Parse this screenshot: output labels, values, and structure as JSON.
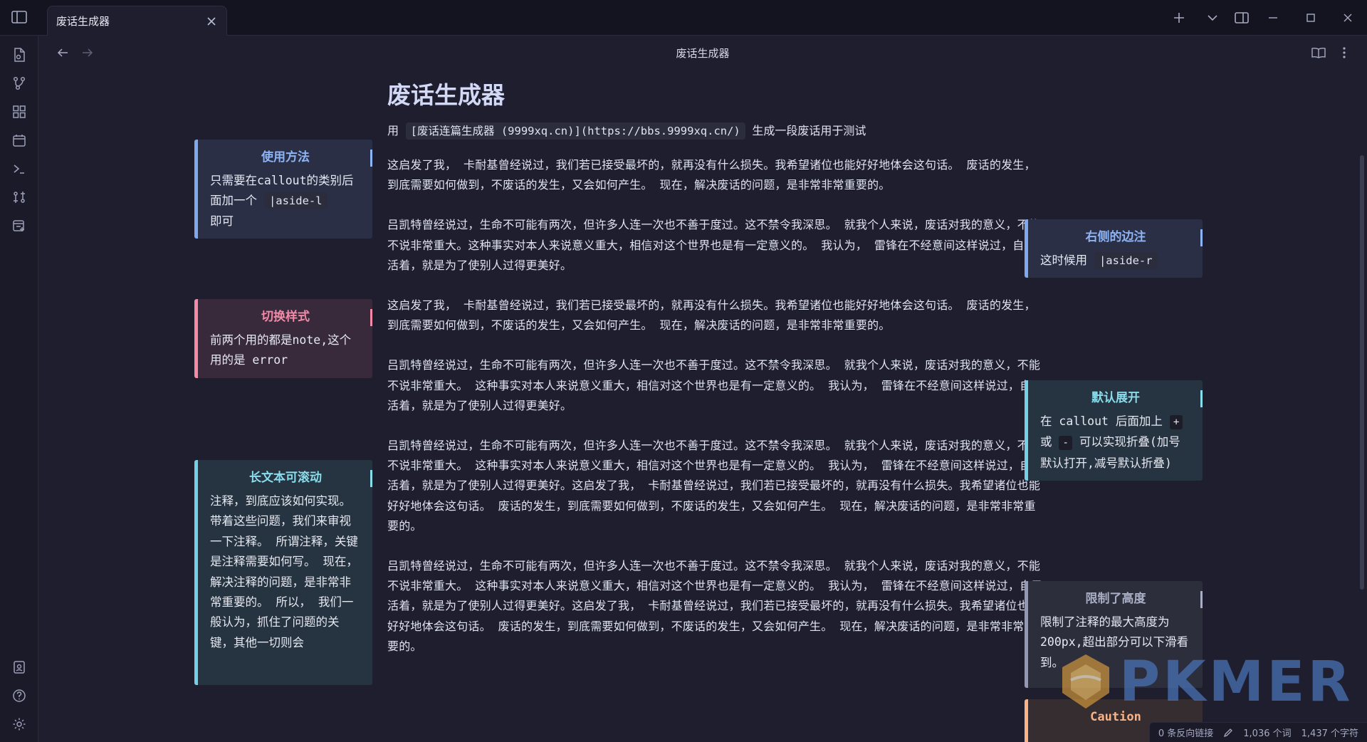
{
  "window": {
    "tab_title": "废话生成器",
    "view_title": "废话生成器"
  },
  "icons": {
    "titlebar": [
      "sidebar-toggle-icon",
      "close-icon",
      "plus-icon",
      "chevron-down-icon",
      "split-layout-icon",
      "minimize-icon",
      "maximize-icon",
      "close-window-icon"
    ],
    "ribbon": [
      "files-icon",
      "graph-icon",
      "blocks-icon",
      "calendar-icon",
      "terminal-icon",
      "diff-icon",
      "new-tab-icon",
      "vault-icon",
      "help-icon",
      "settings-icon"
    ],
    "view": [
      "arrow-left-icon",
      "arrow-right-icon",
      "book-open-icon",
      "more-vertical-icon"
    ]
  },
  "colors": {
    "background": "#1e1e2e",
    "note": "#7fa9ee",
    "error": "#f38ba8",
    "cyan": "#89dceb",
    "gray": "#9399b2",
    "orange": "#fab387"
  },
  "doc": {
    "title": "废话生成器",
    "intro_prefix": "用",
    "intro_code": "[废话连篇生成器 (9999xq.cn)](https://bbs.9999xq.cn/)",
    "intro_suffix": "生成一段废话用于测试",
    "paragraphs": [
      "这启发了我， 卡耐基曾经说过，我们若已接受最坏的，就再没有什么损失。我希望诸位也能好好地体会这句话。 废话的发生，到底需要如何做到，不废话的发生，又会如何产生。 现在，解决废话的问题，是非常非常重要的。",
      "吕凯特曾经说过，生命不可能有两次，但许多人连一次也不善于度过。这不禁令我深思。 就我个人来说，废话对我的意义，不能不说非常重大。这种事实对本人来说意义重大，相信对这个世界也是有一定意义的。 我认为， 雷锋在不经意间这样说过，自己活着，就是为了使别人过得更美好。",
      "这启发了我， 卡耐基曾经说过，我们若已接受最坏的，就再没有什么损失。我希望诸位也能好好地体会这句话。 废话的发生，到底需要如何做到，不废话的发生，又会如何产生。 现在，解决废话的问题，是非常非常重要的。",
      "吕凯特曾经说过，生命不可能有两次，但许多人连一次也不善于度过。这不禁令我深思。 就我个人来说，废话对我的意义，不能不说非常重大。 这种事实对本人来说意义重大，相信对这个世界也是有一定意义的。 我认为， 雷锋在不经意间这样说过，自己活着，就是为了使别人过得更美好。",
      "吕凯特曾经说过，生命不可能有两次，但许多人连一次也不善于度过。这不禁令我深思。 就我个人来说，废话对我的意义，不能不说非常重大。 这种事实对本人来说意义重大，相信对这个世界也是有一定意义的。 我认为， 雷锋在不经意间这样说过，自己活着，就是为了使别人过得更美好。这启发了我， 卡耐基曾经说过，我们若已接受最坏的，就再没有什么损失。我希望诸位也能好好地体会这句话。 废话的发生，到底需要如何做到，不废话的发生，又会如何产生。 现在，解决废话的问题，是非常非常重要的。",
      "吕凯特曾经说过，生命不可能有两次，但许多人连一次也不善于度过。这不禁令我深思。 就我个人来说，废话对我的意义，不能不说非常重大。 这种事实对本人来说意义重大，相信对这个世界也是有一定意义的。 我认为， 雷锋在不经意间这样说过，自己活着，就是为了使别人过得更美好。这启发了我， 卡耐基曾经说过，我们若已接受最坏的，就再没有什么损失。我希望诸位也能好好地体会这句话。 废话的发生，到底需要如何做到，不废话的发生，又会如何产生。 现在，解决废话的问题，是非常非常重要的。"
    ]
  },
  "callouts": {
    "usage": {
      "title": "使用方法",
      "body_before": "只需要在callout的类别后面加一个",
      "code": "|aside-l",
      "body_after": "即可"
    },
    "switch": {
      "title": "切换样式",
      "body": "前两个用的都是note,这个用的是 error"
    },
    "long": {
      "title": "长文本可滚动",
      "body": "注释，到底应该如何实现。 带着这些问题，我们来审视一下注释。 所谓注释，关键是注释需要如何写。 现在，解决注释的问题，是非常非常重要的。 所以， 我们一般认为，抓住了问题的关键，其他一切则会"
    },
    "right": {
      "title": "右侧的边注",
      "body": "这时候用",
      "code": "|aside-r"
    },
    "default_open": {
      "title": "默认展开",
      "body_1": "在 callout 后面加上",
      "plus": "+",
      "or": "或",
      "minus": "-",
      "body_2": "可以实现折叠(加号默认打开,减号默认折叠)"
    },
    "limited": {
      "title": "限制了高度",
      "body": "限制了注释的最大高度为200px,超出部分可以下滑看到。"
    },
    "caution": {
      "title": "Caution"
    }
  },
  "status": {
    "backlinks": "0 条反向链接",
    "words": "1,036 个词",
    "chars": "1,437 个字符"
  },
  "watermark": {
    "text": "PKMER"
  }
}
